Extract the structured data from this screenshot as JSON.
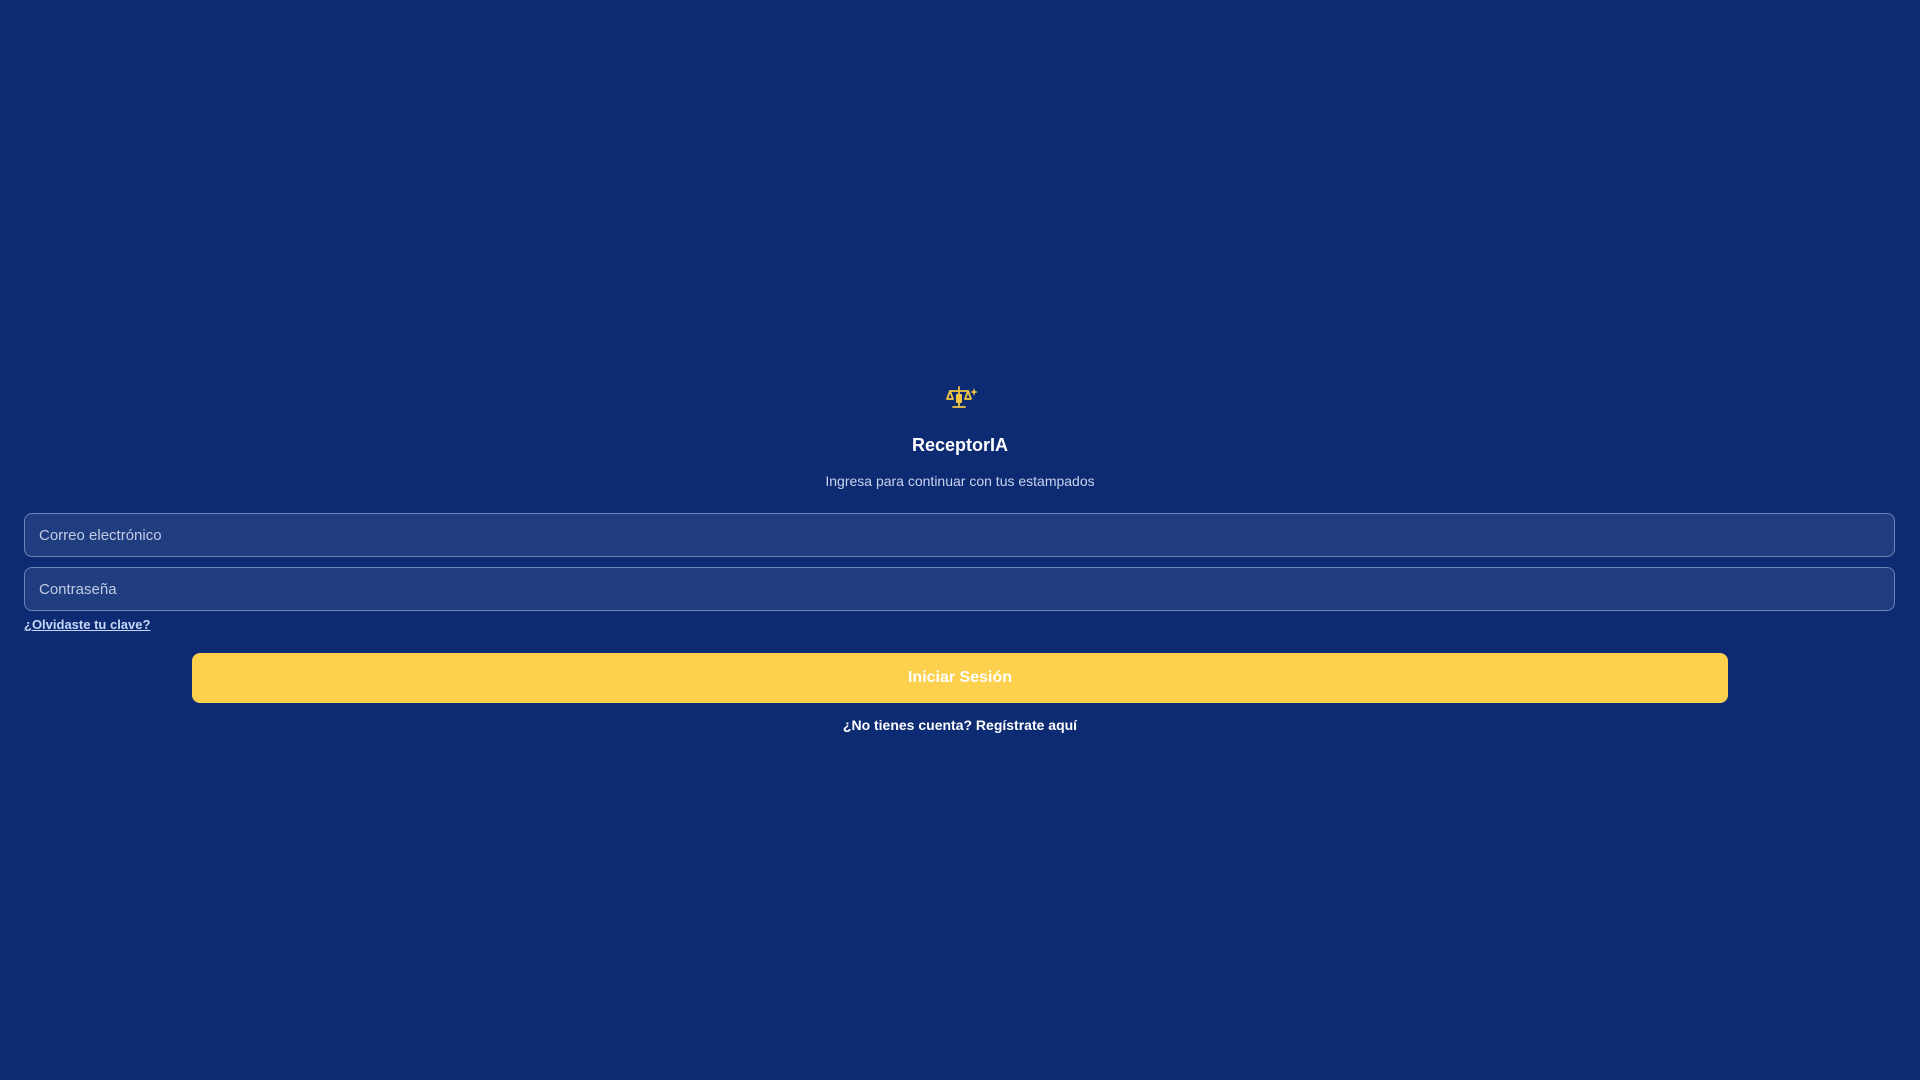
{
  "app": {
    "logo_icon": "balance-scale-sparkle-icon",
    "title": "ReceptorIA",
    "subtitle": "Ingresa para continuar con tus estampados"
  },
  "form": {
    "email_placeholder": "Correo electrónico",
    "email_value": "",
    "password_placeholder": "Contraseña",
    "password_value": "",
    "forgot_link": "¿Olvidaste tu clave?",
    "login_button": "Iniciar Sesión",
    "register_link": "¿No tienes cuenta? Regístrate aquí"
  },
  "colors": {
    "background": "#0d2b73",
    "accent": "#fdd14d",
    "field_background": "#203d80",
    "field_border": "#6e83b8"
  }
}
